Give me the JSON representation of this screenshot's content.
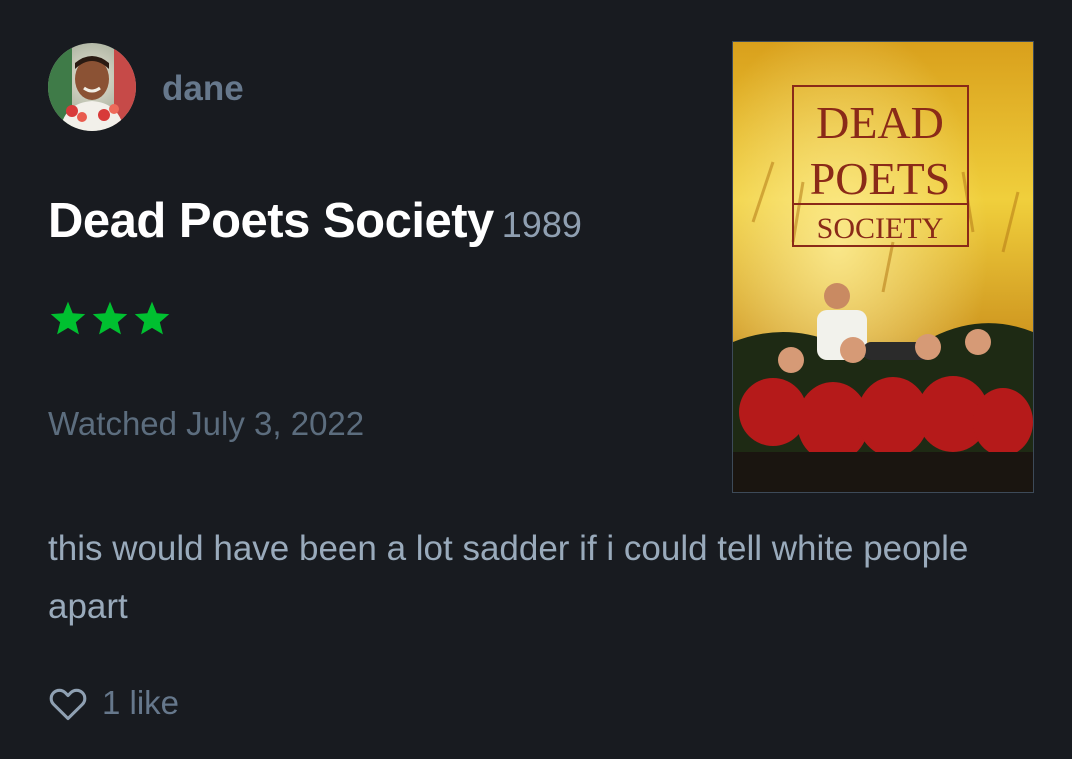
{
  "user": {
    "name": "dane"
  },
  "film": {
    "title": "Dead Poets Society",
    "year": "1989"
  },
  "rating": {
    "stars": 3,
    "color": "#00c030"
  },
  "watched": "Watched July 3, 2022",
  "review": "this would have been a lot sadder if i could tell white people apart",
  "likes": "1 like",
  "poster": {
    "line1": "DEAD",
    "line2": "POETS",
    "line3": "SOCIETY"
  }
}
